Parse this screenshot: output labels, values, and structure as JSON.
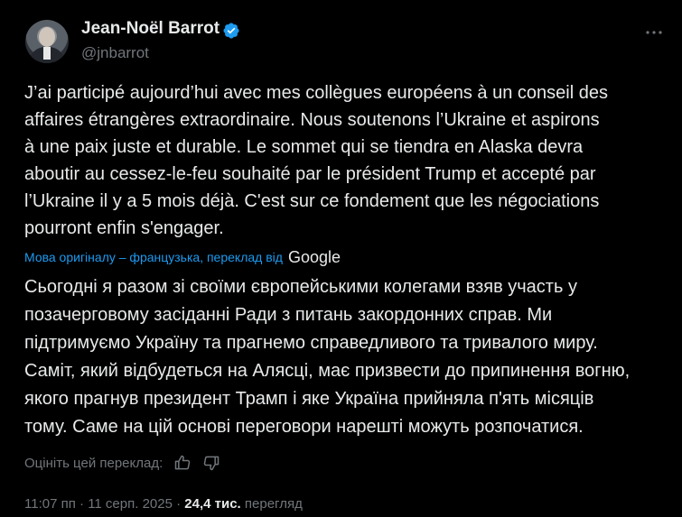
{
  "author": {
    "display_name": "Jean-Noël Barrot",
    "handle": "@jnbarrot",
    "verified": true,
    "verified_color": "#1d9bf0"
  },
  "post": {
    "text": "J’ai participé aujourd’hui avec mes collègues européens à un conseil des\naffaires étrangères extraordinaire. Nous soutenons l’Ukraine et aspirons\nà une paix juste et durable. Le sommet qui se tiendra en Alaska devra\naboutir au cessez-le-feu souhaité par le président Trump et accepté par\nl’Ukraine il y a 5 mois déjà. C'est sur ce fondement que les négociations\npourront enfin s'engager."
  },
  "translation": {
    "label": "Мова оригіналу – французька, переклад від",
    "provider": "Google",
    "text": "Сьогодні я разом зі своїми європейськими колегами взяв участь у\nпозачерговому засіданні Ради з питань закордонних справ. Ми\nпідтримуємо Україну та прагнемо справедливого та тривалого миру.\nСаміт, який відбудеться на Алясці, має призвести до припинення вогню,\nякого прагнув президент Трамп і яке Україна прийняла п'ять місяців\nтому. Саме на цій основі переговори нарешті можуть розпочатися.",
    "rate_label": "Оцініть цей переклад:"
  },
  "meta": {
    "time": "11:07 пп",
    "separator": " · ",
    "date": "11 серп. 2025",
    "views_count": "24,4 тис.",
    "views_label": "перегляд"
  },
  "icons": {
    "verified": "verified-badge-icon",
    "more": "more-horizontal-icon",
    "thumbs_up": "thumbs-up-icon",
    "thumbs_down": "thumbs-down-icon"
  },
  "colors": {
    "background": "#000000",
    "text": "#e7e9ea",
    "secondary": "#71767b",
    "accent": "#1d9bf0"
  }
}
